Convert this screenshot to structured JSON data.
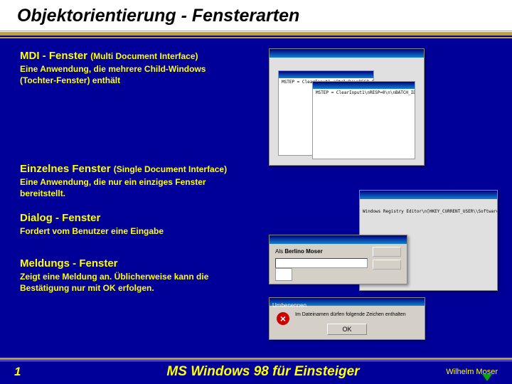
{
  "title": "Objektorientierung - Fensterarten",
  "sections": {
    "mdi": {
      "heading": "MDI - Fenster",
      "paren": "(Multi Document Interface)",
      "desc": "Eine Anwendung, die mehrere Child-Windows (Tochter-Fenster)  enthält"
    },
    "sdi": {
      "heading": "Einzelnes Fenster",
      "paren": "(Single Document Interface)",
      "desc": "Eine Anwendung, die nur ein einziges Fenster bereitstellt."
    },
    "dialog": {
      "heading": "Dialog - Fenster",
      "desc": "Fordert vom Benutzer eine Eingabe"
    },
    "message": {
      "heading": "Meldungs - Fenster",
      "desc": "Zeigt eine Meldung an. Üblicherweise kann die Bestätigung nur mit OK erfolgen."
    }
  },
  "footer": {
    "page": "1",
    "title": "MS Windows 98 für Einsteiger",
    "author": "Wilhelm  Moser"
  },
  "msgbox": {
    "title": "Umbenennen",
    "ok": "OK"
  }
}
